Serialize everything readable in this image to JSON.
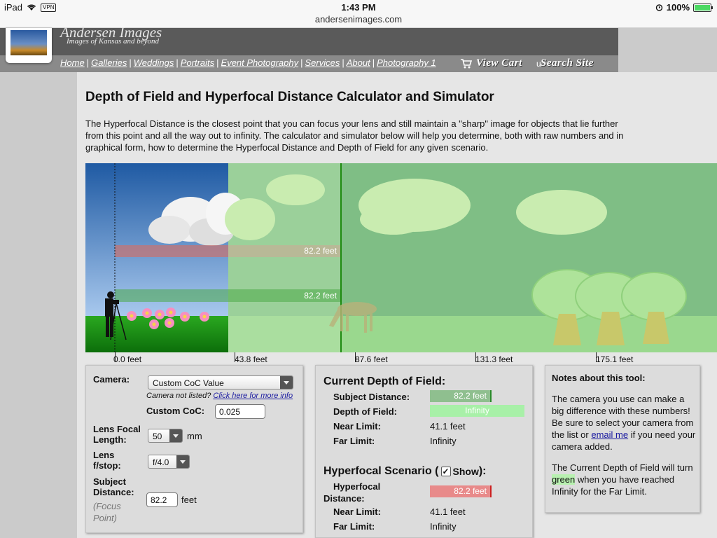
{
  "status_bar": {
    "device": "iPad",
    "vpn": "VPN",
    "time": "1:43 PM",
    "url": "andersenimages.com",
    "battery": "100%"
  },
  "site": {
    "name": "Andersen Images",
    "tagline": "Images of Kansas and beyond"
  },
  "nav": {
    "links": [
      "Home",
      "Galleries",
      "Weddings",
      "Portraits",
      "Event Photography",
      "Services",
      "About",
      "Photography 1"
    ],
    "cart": "View Cart",
    "search_sep": "u",
    "search": "Search Site"
  },
  "page": {
    "title": "Depth of Field and Hyperfocal Distance Calculator and Simulator",
    "intro": "The Hyperfocal Distance is the closest point that you can focus your lens and still maintain a \"sharp\" image for objects that lie further from this point and all the way out to infinity. The calculator and simulator below will help you determine, both with raw numbers and in graphical form, how to determine the Hyperfocal Distance and Depth of Field for any given scenario."
  },
  "simulator": {
    "bar_labels": [
      "82.2 feet",
      "82.2 feet"
    ],
    "ruler": [
      "0.0 feet",
      "43.8 feet",
      "87.6 feet",
      "131.3 feet",
      "175.1 feet"
    ]
  },
  "settings": {
    "camera_label": "Camera:",
    "camera_value": "Custom CoC Value",
    "camera_hint_prefix": "Camera not listed?",
    "camera_hint_link": "Click here for more info",
    "coc_label": "Custom CoC:",
    "coc_value": "0.025",
    "focal_label_1": "Lens Focal",
    "focal_label_2": "Length:",
    "focal_value": "50",
    "focal_unit": "mm",
    "fstop_label_1": "Lens",
    "fstop_label_2": "f/stop:",
    "fstop_value": "f/4.0",
    "subject_label_1": "Subject",
    "subject_label_2": "Distance:",
    "subject_hint_1": "(Focus",
    "subject_hint_2": "Point)",
    "subject_value": "82.2",
    "subject_unit": "feet"
  },
  "results": {
    "current_title": "Current Depth of Field:",
    "subject_label": "Subject Distance:",
    "subject_value": "82.2 feet",
    "dof_label": "Depth of Field:",
    "dof_value": "Infinity",
    "near_label": "Near Limit:",
    "near_value": "41.1 feet",
    "far_label": "Far Limit:",
    "far_value": "Infinity",
    "hyper_title_prefix": "Hyperfocal Scenario (",
    "hyper_show": "Show",
    "hyper_title_suffix": "):",
    "hyper_label_1": "Hyperfocal",
    "hyper_label_2": "Distance:",
    "hyper_value": "82.2 feet",
    "hyper_near_label": "Near Limit:",
    "hyper_near_value": "41.1 feet",
    "hyper_far_label": "Far Limit:",
    "hyper_far_value": "Infinity",
    "show_checked": true
  },
  "notes": {
    "title": "Notes about this tool:",
    "p1_before": "The camera you use can make a big difference with these numbers! Be sure to select your camera from the list or",
    "p1_link": "email me",
    "p1_after": "if you need your camera added.",
    "p2_before": "The Current Depth of Field will turn",
    "p2_highlight": "green",
    "p2_after": "when you have reached Infinity for the Far Limit."
  },
  "colors": {
    "sharp_sky": "#2b63a8",
    "grass": "#1f9a1a",
    "blur_overlay": "#9cd39a",
    "hyper_bar": "#e88a8a",
    "dof_bar": "#a8f0a8",
    "subject_bar": "#8fbf8f",
    "focus_line": "#1e8a10"
  }
}
